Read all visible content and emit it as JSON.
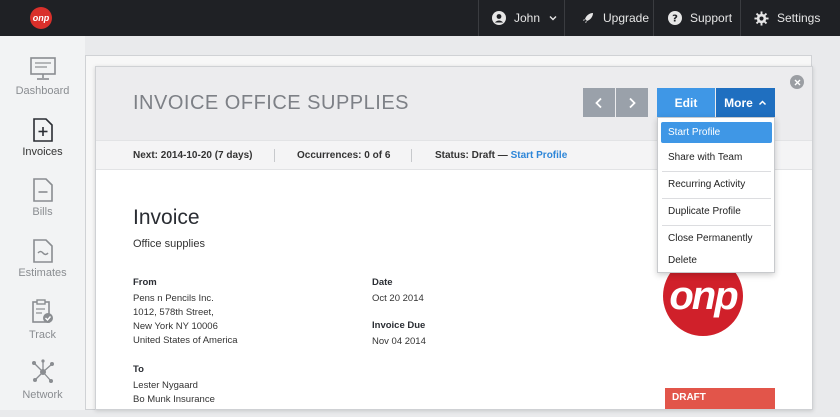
{
  "brand": {
    "logo_text": "onp",
    "accent": "#d9302b"
  },
  "topnav": {
    "user": "John",
    "upgrade": "Upgrade",
    "support": "Support",
    "settings": "Settings"
  },
  "sidebar": {
    "items": [
      {
        "label": "Dashboard",
        "icon": "monitor-icon"
      },
      {
        "label": "Invoices",
        "icon": "invoice-add-icon",
        "active": true
      },
      {
        "label": "Bills",
        "icon": "bill-icon"
      },
      {
        "label": "Estimates",
        "icon": "estimate-icon"
      },
      {
        "label": "Track",
        "icon": "clipboard-check-icon"
      },
      {
        "label": "Network",
        "icon": "network-icon"
      }
    ]
  },
  "modal": {
    "title": "INVOICE OFFICE SUPPLIES",
    "prev": "‹",
    "next": "›",
    "edit": "Edit",
    "more": "More",
    "close": "✕"
  },
  "infobar": {
    "next": "Next: 2014-10-20 (7 days)",
    "occurrences": "Occurrences: 0 of 6",
    "status": "Status: Draft —",
    "status_link": "Start Profile"
  },
  "invoice": {
    "heading": "Invoice",
    "subtitle": "Office supplies",
    "from_label": "From",
    "from_lines": [
      "Pens n Pencils Inc.",
      "1012, 578th Street,",
      "New York NY 10006",
      "United States of America"
    ],
    "to_label": "To",
    "to_lines": [
      "Lester Nygaard",
      "Bo Munk Insurance"
    ],
    "date_label": "Date",
    "date_value": "Oct 20 2014",
    "due_label": "Invoice Due",
    "due_value": "Nov 04 2014",
    "stamp_text": "onp",
    "draft_badge": "DRAFT"
  },
  "more_menu": {
    "items": [
      "Start Profile",
      "Share with Team",
      "Recurring Activity",
      "Duplicate Profile",
      "Close Permanently",
      "Delete"
    ],
    "selected": "Start Profile"
  }
}
